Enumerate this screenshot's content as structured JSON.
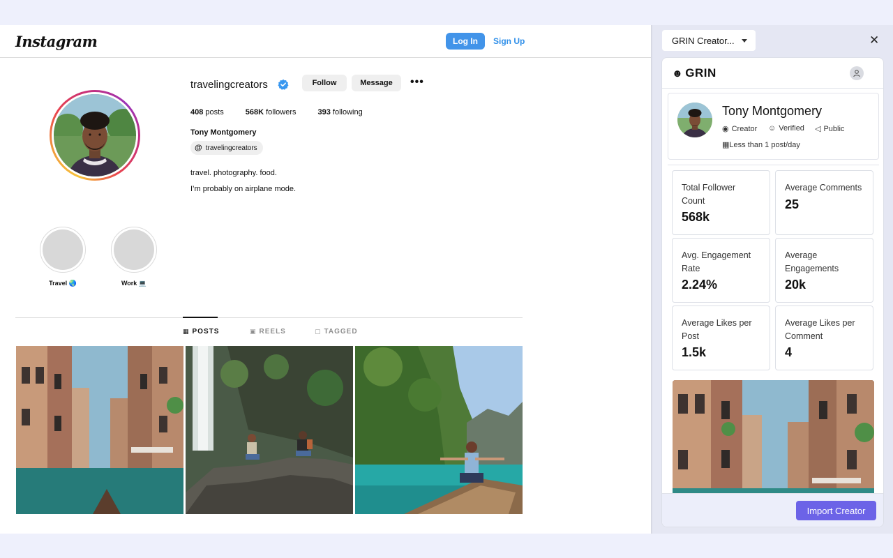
{
  "instagram": {
    "logo": "Instagram",
    "login_label": "Log In",
    "signup_label": "Sign Up",
    "username": "travelingcreators",
    "follow_label": "Follow",
    "message_label": "Message",
    "more_label": "•••",
    "stats": {
      "posts_count": "408",
      "posts_label": "posts",
      "followers_count": "568K",
      "followers_label": "followers",
      "following_count": "393",
      "following_label": "following"
    },
    "full_name": "Tony Montgomery",
    "threads_handle": "travelingcreators",
    "bio_line1": "travel. photography. food.",
    "bio_line2": "I’m probably on airplane mode.",
    "highlights": [
      {
        "label": "Travel 🌏"
      },
      {
        "label": "Work 💻"
      }
    ],
    "tabs": [
      {
        "label": "POSTS",
        "icon": "grid-icon"
      },
      {
        "label": "REELS",
        "icon": "reels-icon"
      },
      {
        "label": "TAGGED",
        "icon": "tagged-icon"
      }
    ],
    "posts": [
      {
        "subject": "venice canal"
      },
      {
        "subject": "waterfall rocks"
      },
      {
        "subject": "boat lake"
      }
    ]
  },
  "grin": {
    "dropdown_label": "GRIN Creator...",
    "close_label": "✕",
    "logo": "GRIN",
    "creator": {
      "name": "Tony Montgomery",
      "role": "Creator",
      "verified": "Verified",
      "visibility": "Public",
      "post_frequency": "Less than 1 post/day"
    },
    "metrics": [
      {
        "label": "Total Follower Count",
        "value": "568k"
      },
      {
        "label": "Average Comments",
        "value": "25"
      },
      {
        "label": "Avg. Engagement Rate",
        "value": "2.24%"
      },
      {
        "label": "Average Engagements",
        "value": "20k"
      },
      {
        "label": "Average Likes per Post",
        "value": "1.5k"
      },
      {
        "label": "Average Likes per Comment",
        "value": "4"
      }
    ],
    "import_label": "Import Creator"
  },
  "colors": {
    "ig_blue": "#4294e9",
    "grin_purple": "#6c63e7",
    "panel_bg": "#e5e7f3"
  }
}
